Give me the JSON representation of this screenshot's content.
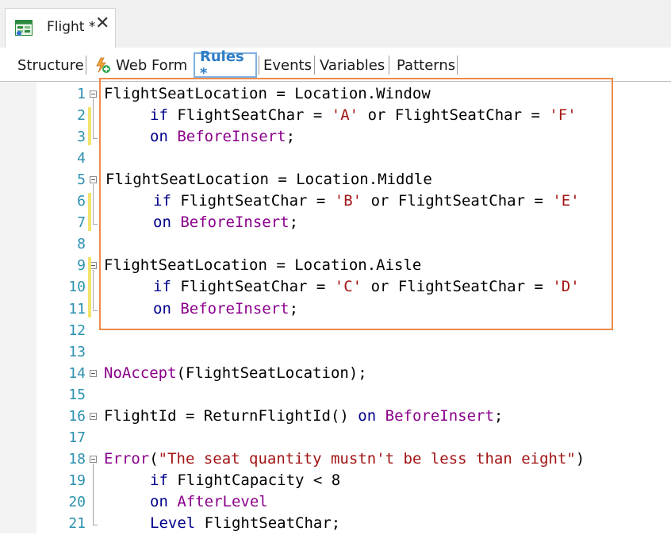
{
  "window": {
    "tab_title": "Flight *",
    "close_glyph": "✕",
    "tab_icon": "transaction-icon"
  },
  "toolbar": {
    "items": [
      {
        "label": "Structure"
      },
      {
        "label": "Web Form",
        "icon": "webform-icon"
      },
      {
        "label": "Rules *",
        "active": true
      },
      {
        "label": "Events"
      },
      {
        "label": "Variables"
      },
      {
        "label": "Patterns"
      }
    ]
  },
  "colors": {
    "highlight_border": "#ee8a4a",
    "line_number": "#2b91af",
    "keyword": "#00008b",
    "event": "#8b008b",
    "string": "#a31515"
  },
  "editor": {
    "lines": [
      {
        "n": "1",
        "segments": [
          {
            "t": "FlightSeatLocation = Location.Window",
            "c": ""
          }
        ]
      },
      {
        "n": "2",
        "segments": [
          {
            "t": "if",
            "c": "kw"
          },
          {
            "t": " FlightSeatChar = ",
            "c": ""
          },
          {
            "t": "'A'",
            "c": "str"
          },
          {
            "t": " or FlightSeatChar = ",
            "c": ""
          },
          {
            "t": "'F'",
            "c": "str"
          }
        ]
      },
      {
        "n": "3",
        "segments": [
          {
            "t": "on",
            "c": "kw"
          },
          {
            "t": " ",
            "c": ""
          },
          {
            "t": "BeforeInsert",
            "c": "ev"
          },
          {
            "t": ";",
            "c": ""
          }
        ]
      },
      {
        "n": "4",
        "segments": []
      },
      {
        "n": "5",
        "segments": [
          {
            "t": "FlightSeatLocation = Location.Middle",
            "c": ""
          }
        ]
      },
      {
        "n": "6",
        "segments": [
          {
            "t": "if",
            "c": "kw"
          },
          {
            "t": " FlightSeatChar = ",
            "c": ""
          },
          {
            "t": "'B'",
            "c": "str"
          },
          {
            "t": " or FlightSeatChar = ",
            "c": ""
          },
          {
            "t": "'E'",
            "c": "str"
          }
        ]
      },
      {
        "n": "7",
        "segments": [
          {
            "t": "on",
            "c": "kw"
          },
          {
            "t": " ",
            "c": ""
          },
          {
            "t": "BeforeInsert",
            "c": "ev"
          },
          {
            "t": ";",
            "c": ""
          }
        ]
      },
      {
        "n": "8",
        "segments": []
      },
      {
        "n": "9",
        "segments": [
          {
            "t": "FlightSeatLocation = Location.Aisle",
            "c": ""
          }
        ]
      },
      {
        "n": "10",
        "segments": [
          {
            "t": "if",
            "c": "kw"
          },
          {
            "t": " FlightSeatChar = ",
            "c": ""
          },
          {
            "t": "'C'",
            "c": "str"
          },
          {
            "t": " or FlightSeatChar = ",
            "c": ""
          },
          {
            "t": "'D'",
            "c": "str"
          }
        ]
      },
      {
        "n": "11",
        "segments": [
          {
            "t": "on",
            "c": "kw"
          },
          {
            "t": " ",
            "c": ""
          },
          {
            "t": "BeforeInsert",
            "c": "ev"
          },
          {
            "t": ";",
            "c": ""
          }
        ]
      },
      {
        "n": "12",
        "segments": []
      },
      {
        "n": "13",
        "segments": []
      },
      {
        "n": "14",
        "segments": [
          {
            "t": "NoAccept",
            "c": "ev"
          },
          {
            "t": "(FlightSeatLocation);",
            "c": ""
          }
        ]
      },
      {
        "n": "15",
        "segments": []
      },
      {
        "n": "16",
        "segments": [
          {
            "t": "FlightId = ReturnFlightId() ",
            "c": ""
          },
          {
            "t": "on",
            "c": "kw"
          },
          {
            "t": " ",
            "c": ""
          },
          {
            "t": "BeforeInsert",
            "c": "ev"
          },
          {
            "t": ";",
            "c": ""
          }
        ]
      },
      {
        "n": "17",
        "segments": []
      },
      {
        "n": "18",
        "segments": [
          {
            "t": "Error",
            "c": "ev"
          },
          {
            "t": "(",
            "c": ""
          },
          {
            "t": "\"The seat quantity mustn't be less than eight\"",
            "c": "str"
          },
          {
            "t": ")",
            "c": ""
          }
        ]
      },
      {
        "n": "19",
        "segments": [
          {
            "t": "if",
            "c": "kw"
          },
          {
            "t": " FlightCapacity < 8",
            "c": ""
          }
        ]
      },
      {
        "n": "20",
        "segments": [
          {
            "t": "on",
            "c": "kw"
          },
          {
            "t": " ",
            "c": ""
          },
          {
            "t": "AfterLevel",
            "c": "ev"
          }
        ]
      },
      {
        "n": "21",
        "segments": [
          {
            "t": "Level",
            "c": "kw"
          },
          {
            "t": " FlightSeatChar;",
            "c": ""
          }
        ]
      }
    ]
  }
}
